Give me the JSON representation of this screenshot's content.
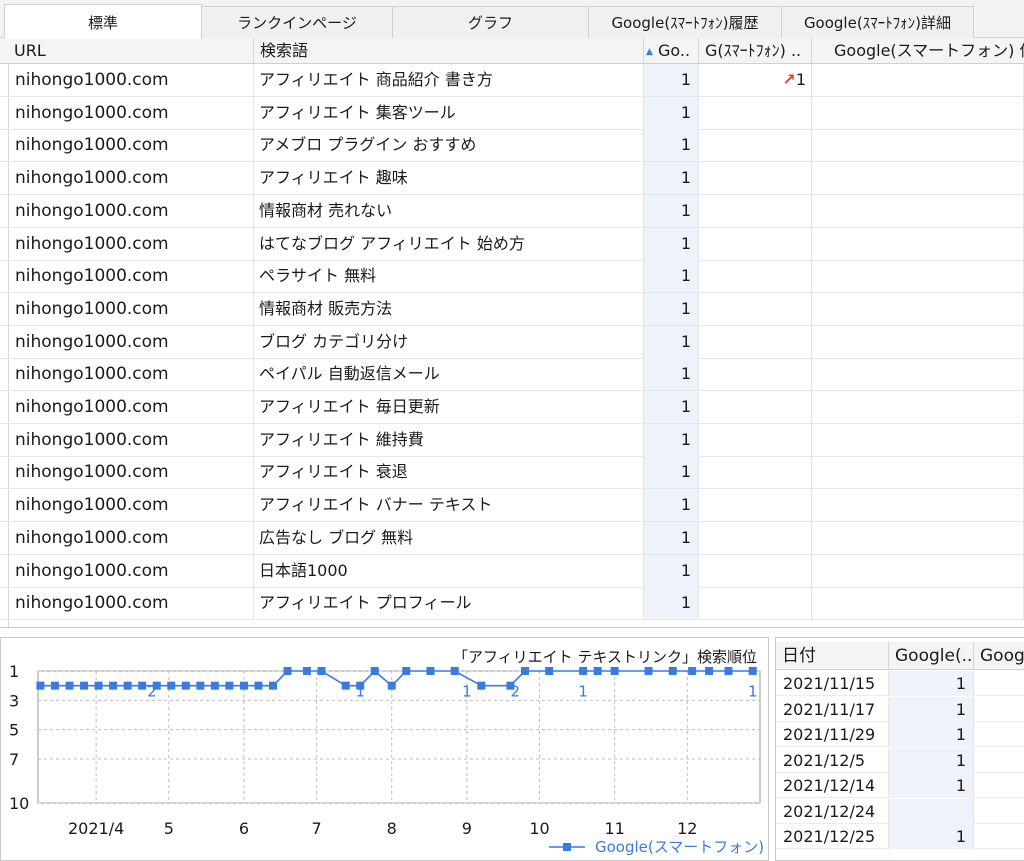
{
  "tabs": [
    "標準",
    "ランクインページ",
    "グラフ",
    "Google(ｽﾏｰﾄﾌｫﾝ)履歴",
    "Google(ｽﾏｰﾄﾌｫﾝ)詳細"
  ],
  "grid": {
    "headers": {
      "url": "URL",
      "keyword": "検索語",
      "google": "Go..",
      "google_sp": "G(ｽﾏｰﾄﾌｫﾝ) ..",
      "google_count": "Google(スマートフォン) 件数"
    },
    "sort_indicator": "▲",
    "rows": [
      {
        "url": "nihongo1000.com",
        "keyword": "アフィリエイト 商品紹介 書き方",
        "google": "1",
        "sp": "1"
      },
      {
        "url": "nihongo1000.com",
        "keyword": "アフィリエイト 集客ツール",
        "google": "1",
        "sp": ""
      },
      {
        "url": "nihongo1000.com",
        "keyword": "アメブロ プラグイン おすすめ",
        "google": "1",
        "sp": ""
      },
      {
        "url": "nihongo1000.com",
        "keyword": "アフィリエイト 趣味",
        "google": "1",
        "sp": ""
      },
      {
        "url": "nihongo1000.com",
        "keyword": "情報商材 売れない",
        "google": "1",
        "sp": ""
      },
      {
        "url": "nihongo1000.com",
        "keyword": "はてなブログ アフィリエイト 始め方",
        "google": "1",
        "sp": ""
      },
      {
        "url": "nihongo1000.com",
        "keyword": "ペラサイト 無料",
        "google": "1",
        "sp": ""
      },
      {
        "url": "nihongo1000.com",
        "keyword": "情報商材 販売方法",
        "google": "1",
        "sp": ""
      },
      {
        "url": "nihongo1000.com",
        "keyword": "ブログ カテゴリ分け",
        "google": "1",
        "sp": ""
      },
      {
        "url": "nihongo1000.com",
        "keyword": "ペイパル 自動返信メール",
        "google": "1",
        "sp": ""
      },
      {
        "url": "nihongo1000.com",
        "keyword": "アフィリエイト 毎日更新",
        "google": "1",
        "sp": ""
      },
      {
        "url": "nihongo1000.com",
        "keyword": "アフィリエイト 維持費",
        "google": "1",
        "sp": ""
      },
      {
        "url": "nihongo1000.com",
        "keyword": "アフィリエイト 衰退",
        "google": "1",
        "sp": ""
      },
      {
        "url": "nihongo1000.com",
        "keyword": "アフィリエイト バナー テキスト",
        "google": "1",
        "sp": ""
      },
      {
        "url": "nihongo1000.com",
        "keyword": "広告なし ブログ 無料",
        "google": "1",
        "sp": ""
      },
      {
        "url": "nihongo1000.com",
        "keyword": "日本語1000",
        "google": "1",
        "sp": ""
      },
      {
        "url": "nihongo1000.com",
        "keyword": "アフィリエイト プロフィール",
        "google": "1",
        "sp": ""
      }
    ]
  },
  "colors": {
    "series": "#3a7be0",
    "up_arrow": "#e04a2a",
    "rank_column_bg": "#eef2fa"
  },
  "chart_data": {
    "type": "line",
    "title": "「アフィリエイト テキストリンク」検索順位",
    "legend": "Google(スマートフォン)",
    "legend_position": "bottom-right",
    "ylim": [
      10,
      1
    ],
    "y_reversed": true,
    "y_ticks": [
      "1",
      "3",
      "5",
      "7",
      "10"
    ],
    "x_ticks": [
      "2021/4",
      "5",
      "6",
      "7",
      "8",
      "9",
      "10",
      "11",
      "12"
    ],
    "grid": true,
    "series": [
      {
        "name": "Google(スマートフォン)",
        "points": [
          {
            "date": "2021-03-09",
            "rank": 2
          },
          {
            "date": "2021-03-15",
            "rank": 2
          },
          {
            "date": "2021-03-21",
            "rank": 2
          },
          {
            "date": "2021-03-27",
            "rank": 2
          },
          {
            "date": "2021-04-02",
            "rank": 2
          },
          {
            "date": "2021-04-08",
            "rank": 2
          },
          {
            "date": "2021-04-14",
            "rank": 2
          },
          {
            "date": "2021-04-20",
            "rank": 2
          },
          {
            "date": "2021-04-26",
            "rank": 2
          },
          {
            "date": "2021-05-02",
            "rank": 2
          },
          {
            "date": "2021-05-08",
            "rank": 2
          },
          {
            "date": "2021-05-14",
            "rank": 2
          },
          {
            "date": "2021-05-20",
            "rank": 2
          },
          {
            "date": "2021-05-26",
            "rank": 2
          },
          {
            "date": "2021-06-01",
            "rank": 2
          },
          {
            "date": "2021-06-07",
            "rank": 2
          },
          {
            "date": "2021-06-13",
            "rank": 2
          },
          {
            "date": "2021-06-19",
            "rank": 1
          },
          {
            "date": "2021-06-27",
            "rank": 1
          },
          {
            "date": "2021-07-03",
            "rank": 1
          },
          {
            "date": "2021-07-13",
            "rank": 2
          },
          {
            "date": "2021-07-19",
            "rank": 2
          },
          {
            "date": "2021-07-25",
            "rank": 1
          },
          {
            "date": "2021-08-01",
            "rank": 2
          },
          {
            "date": "2021-08-07",
            "rank": 1
          },
          {
            "date": "2021-08-17",
            "rank": 1
          },
          {
            "date": "2021-08-27",
            "rank": 1
          },
          {
            "date": "2021-09-07",
            "rank": 2
          },
          {
            "date": "2021-09-19",
            "rank": 2
          },
          {
            "date": "2021-09-25",
            "rank": 1
          },
          {
            "date": "2021-10-05",
            "rank": 1
          },
          {
            "date": "2021-10-19",
            "rank": 1
          },
          {
            "date": "2021-10-25",
            "rank": 1
          },
          {
            "date": "2021-11-01",
            "rank": 1
          },
          {
            "date": "2021-11-15",
            "rank": 1
          },
          {
            "date": "2021-11-25",
            "rank": 1
          },
          {
            "date": "2021-12-03",
            "rank": 1
          },
          {
            "date": "2021-12-10",
            "rank": 1
          },
          {
            "date": "2021-12-18",
            "rank": 1
          },
          {
            "date": "2021-12-28",
            "rank": 1
          }
        ]
      }
    ],
    "point_labels": [
      {
        "date": "2021-04-24",
        "text": "2"
      },
      {
        "date": "2021-07-19",
        "text": "1"
      },
      {
        "date": "2021-09-01",
        "text": "1"
      },
      {
        "date": "2021-09-21",
        "text": "2"
      },
      {
        "date": "2021-10-19",
        "text": "1"
      },
      {
        "date": "2021-12-28",
        "text": "1"
      }
    ]
  },
  "history": {
    "headers": {
      "date": "日付",
      "google": "Google(..",
      "google2": "Goog.."
    },
    "rows": [
      {
        "date": "2021/11/15",
        "rank": "1"
      },
      {
        "date": "2021/11/17",
        "rank": "1"
      },
      {
        "date": "2021/11/29",
        "rank": "1"
      },
      {
        "date": "2021/12/5",
        "rank": "1"
      },
      {
        "date": "2021/12/14",
        "rank": "1"
      },
      {
        "date": "2021/12/24",
        "rank": ""
      },
      {
        "date": "2021/12/25",
        "rank": "1"
      }
    ]
  }
}
